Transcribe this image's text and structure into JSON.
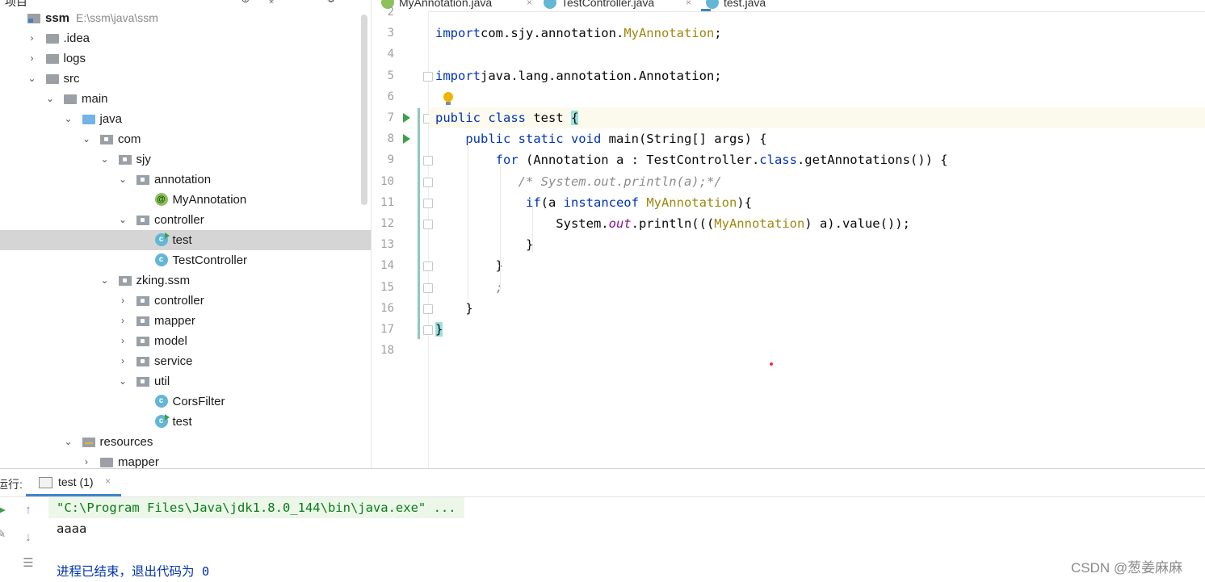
{
  "project": {
    "title": "项目",
    "header_icons": [
      "globe-icon",
      "collapse-icon",
      "up-icon",
      "gear-icon"
    ],
    "tree": [
      {
        "label": "ssm",
        "sub": "E:\\ssm\\java\\ssm",
        "icon": "root-folder-icon",
        "depth": 0,
        "expand": "none"
      },
      {
        "label": ".idea",
        "icon": "folder-icon",
        "depth": 1,
        "expand": "collapsed"
      },
      {
        "label": "logs",
        "icon": "folder-icon",
        "depth": 1,
        "expand": "collapsed"
      },
      {
        "label": "src",
        "icon": "folder-icon",
        "depth": 1,
        "expand": "expanded"
      },
      {
        "label": "main",
        "icon": "folder-icon",
        "depth": 2,
        "expand": "expanded"
      },
      {
        "label": "java",
        "icon": "source-folder-icon",
        "depth": 3,
        "expand": "expanded"
      },
      {
        "label": "com",
        "icon": "package-icon",
        "depth": 4,
        "expand": "expanded"
      },
      {
        "label": "sjy",
        "icon": "package-icon",
        "depth": 5,
        "expand": "expanded"
      },
      {
        "label": "annotation",
        "icon": "package-icon",
        "depth": 6,
        "expand": "expanded"
      },
      {
        "label": "MyAnnotation",
        "icon": "annotation-icon",
        "depth": 7,
        "expand": "none"
      },
      {
        "label": "controller",
        "icon": "package-icon",
        "depth": 6,
        "expand": "expanded"
      },
      {
        "label": "test",
        "icon": "class-run-icon",
        "depth": 7,
        "expand": "none",
        "selected": true
      },
      {
        "label": "TestController",
        "icon": "class-icon",
        "depth": 7,
        "expand": "none"
      },
      {
        "label": "zking.ssm",
        "icon": "package-icon",
        "depth": 5,
        "expand": "expanded"
      },
      {
        "label": "controller",
        "icon": "package-icon",
        "depth": 6,
        "expand": "collapsed"
      },
      {
        "label": "mapper",
        "icon": "package-icon",
        "depth": 6,
        "expand": "collapsed"
      },
      {
        "label": "model",
        "icon": "package-icon",
        "depth": 6,
        "expand": "collapsed"
      },
      {
        "label": "service",
        "icon": "package-icon",
        "depth": 6,
        "expand": "collapsed"
      },
      {
        "label": "util",
        "icon": "package-icon",
        "depth": 6,
        "expand": "expanded"
      },
      {
        "label": "CorsFilter",
        "icon": "class-icon",
        "depth": 7,
        "expand": "none"
      },
      {
        "label": "test",
        "icon": "class-run-icon",
        "depth": 7,
        "expand": "none"
      },
      {
        "label": "resources",
        "icon": "resources-folder-icon",
        "depth": 3,
        "expand": "expanded"
      },
      {
        "label": "mapper",
        "icon": "folder-icon",
        "depth": 4,
        "expand": "collapsed"
      }
    ]
  },
  "editor": {
    "tabs": [
      {
        "label": "MyAnnotation.java",
        "icon": "annotation-icon",
        "active": false
      },
      {
        "label": "TestController.java",
        "icon": "class-icon",
        "active": false
      },
      {
        "label": "test.java",
        "icon": "class-run-icon",
        "active": true
      }
    ],
    "lines": [
      {
        "n": "2",
        "tokens": []
      },
      {
        "n": "3",
        "tokens": [
          [
            "kw",
            "import"
          ],
          [
            "",
            "com.sjy.annotation."
          ],
          [
            "ty",
            "MyAnnotation"
          ],
          [
            "",
            ";"
          ]
        ]
      },
      {
        "n": "4",
        "tokens": []
      },
      {
        "n": "5",
        "tokens": [
          [
            "kw",
            "import"
          ],
          [
            "",
            "java.lang.annotation.Annotation;"
          ]
        ]
      },
      {
        "n": "6",
        "tokens": []
      },
      {
        "n": "7",
        "current": true,
        "run": true,
        "tokens": [
          [
            "kw",
            "public class "
          ],
          [
            "",
            "test "
          ],
          [
            "br",
            "{"
          ]
        ]
      },
      {
        "n": "8",
        "run": true,
        "tokens": [
          [
            "",
            "    "
          ],
          [
            "kw",
            "public static void "
          ],
          [
            "",
            "main(String[] args) {"
          ]
        ]
      },
      {
        "n": "9",
        "tokens": [
          [
            "",
            "        "
          ],
          [
            "kw",
            "for "
          ],
          [
            "",
            "(Annotation a : TestController."
          ],
          [
            "kw",
            "class"
          ],
          [
            "",
            ".getAnnotations()) {"
          ]
        ]
      },
      {
        "n": "10",
        "tokens": [
          [
            "",
            "           "
          ],
          [
            "cm",
            "/* System.out.println(a);*/"
          ]
        ]
      },
      {
        "n": "11",
        "tokens": [
          [
            "",
            "            "
          ],
          [
            "kw",
            "if"
          ],
          [
            "",
            "(a "
          ],
          [
            "kw",
            "instanceof "
          ],
          [
            "ty",
            "MyAnnotation"
          ],
          [
            "",
            "){"
          ]
        ]
      },
      {
        "n": "12",
        "tokens": [
          [
            "",
            "                System."
          ],
          [
            "st",
            "out"
          ],
          [
            "",
            ".println((("
          ],
          [
            "ty",
            "MyAnnotation"
          ],
          [
            "",
            ") a).value());"
          ]
        ]
      },
      {
        "n": "13",
        "tokens": [
          [
            "",
            "            }"
          ]
        ]
      },
      {
        "n": "14",
        "tokens": [
          [
            "",
            "        }"
          ]
        ]
      },
      {
        "n": "15",
        "tokens": [
          [
            "",
            "        "
          ],
          [
            "cm",
            ";"
          ]
        ]
      },
      {
        "n": "16",
        "tokens": [
          [
            "",
            "    }"
          ]
        ]
      },
      {
        "n": "17",
        "tokens": [
          [
            "br",
            "}"
          ]
        ]
      },
      {
        "n": "18",
        "tokens": []
      }
    ]
  },
  "run": {
    "title": "运行:",
    "tab_label": "test (1)",
    "tab_close": "×",
    "console": {
      "command": "\"C:\\Program Files\\Java\\jdk1.8.0_144\\bin\\java.exe\" ...",
      "output": "aaaa",
      "exit_message": "进程已结束，退出代码为 0"
    }
  },
  "watermark": "CSDN @葱姜麻麻",
  "colors": {
    "keyword": "#0033b3",
    "type": "#9e880d",
    "comment": "#8c8c8c",
    "static_field": "#871094",
    "console_command": "#067d17",
    "selection": "#d5d5d5",
    "active_tab": "#4083c9"
  }
}
